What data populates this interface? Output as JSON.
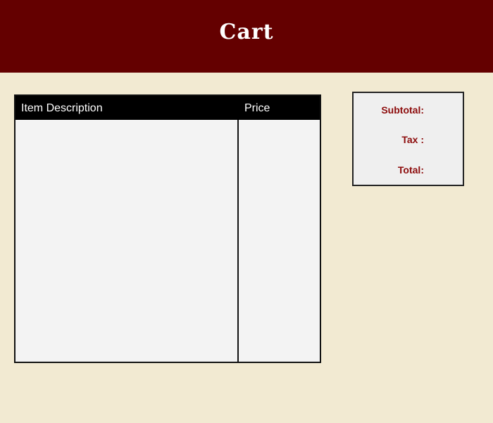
{
  "header": {
    "title": "Cart"
  },
  "table": {
    "columns": [
      "Item Description",
      "Price"
    ],
    "rows": []
  },
  "summary": {
    "subtotal_label": "Subtotal:",
    "tax_label": "Tax :",
    "total_label": "Total:",
    "subtotal_value": "",
    "tax_value": "",
    "total_value": ""
  },
  "colors": {
    "header_bg": "#640000",
    "page_bg": "#f2ead2",
    "label_color": "#8c0b0b",
    "table_header_bg": "#000000"
  }
}
